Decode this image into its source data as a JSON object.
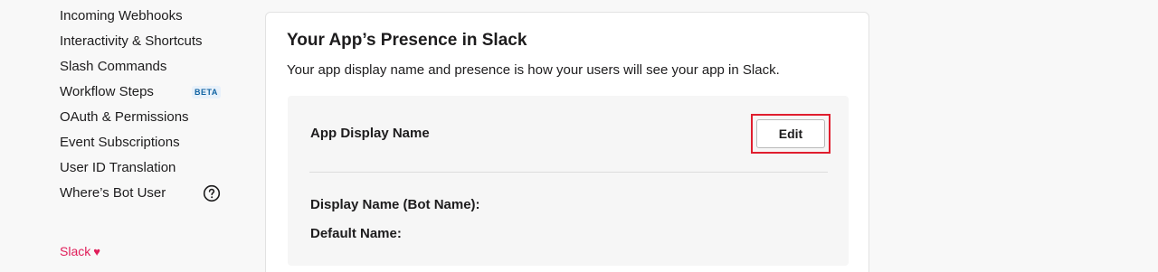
{
  "sidebar": {
    "items": [
      {
        "label": "Incoming Webhooks"
      },
      {
        "label": "Interactivity & Shortcuts"
      },
      {
        "label": "Slash Commands"
      },
      {
        "label": "Workflow Steps",
        "badge": "BETA"
      },
      {
        "label": "OAuth & Permissions"
      },
      {
        "label": "Event Subscriptions"
      },
      {
        "label": "User ID Translation"
      },
      {
        "label": "Where’s Bot User",
        "icon": "question-circle-icon"
      }
    ],
    "footer": {
      "label": "Slack",
      "icon": "heart-icon",
      "heart_glyph": "♥"
    }
  },
  "main": {
    "card_title": "Your App’s Presence in Slack",
    "card_description": "Your app display name and presence is how your users will see your app in Slack.",
    "panel": {
      "title": "App Display Name",
      "edit_label": "Edit",
      "fields": [
        {
          "label": "Display Name (Bot Name):"
        },
        {
          "label": "Default Name:"
        }
      ]
    }
  },
  "colors": {
    "accent_red": "#e01e5a",
    "highlight_border": "#e01e2e",
    "beta_text": "#1264a3",
    "beta_bg": "#e8f1fa"
  }
}
